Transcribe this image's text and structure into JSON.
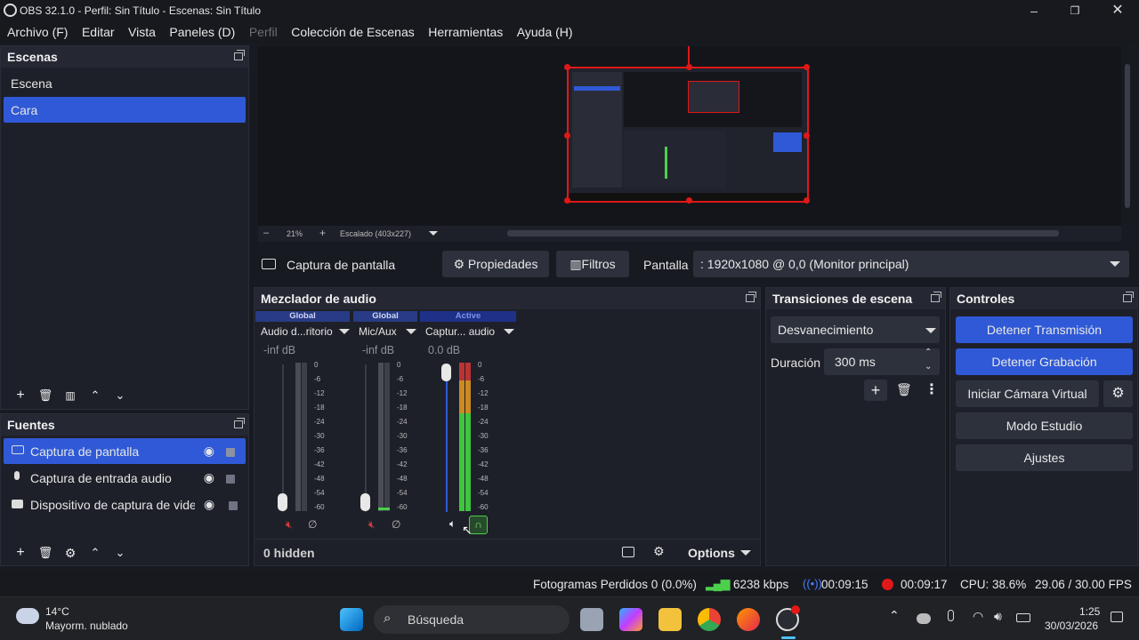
{
  "window": {
    "title": "OBS 32.1.0 - Perfil: Sin Título - Escenas: Sin Título"
  },
  "menu": [
    "Archivo (F)",
    "Editar",
    "Vista",
    "Paneles (D)",
    "Perfil",
    "Colección de Escenas",
    "Herramientas",
    "Ayuda (H)"
  ],
  "scenes": {
    "title": "Escenas",
    "items": [
      "Escena",
      "Cara"
    ],
    "selected_index": 1
  },
  "sources": {
    "title": "Fuentes",
    "items": [
      "Captura de pantalla",
      "Captura de entrada audio",
      "Dispositivo de captura de video"
    ]
  },
  "preview": {
    "zoom": "21%",
    "scale_label": "Escalado (403x227)"
  },
  "source_bar": {
    "source_name": "Captura de pantalla",
    "properties_label": "Propiedades",
    "filters_label": "Filtros",
    "display_label": "Pantalla",
    "display_value": ": 1920x1080 @ 0,0 (Monitor principal)"
  },
  "mixer": {
    "title": "Mezclador de audio",
    "channels": [
      {
        "badge": "Global",
        "name": "Audio d...ritorio",
        "db": "-inf dB",
        "level": 0.0
      },
      {
        "badge": "Global",
        "name": "Mic/Aux",
        "db": "-inf dB",
        "level": 0.0
      },
      {
        "badge": "Active",
        "name": "Captur... audio",
        "db": "0.0 dB",
        "level": 1.0
      }
    ],
    "scale": [
      "0",
      "-6",
      "-12",
      "-18",
      "-24",
      "-30",
      "-36",
      "-42",
      "-48",
      "-54",
      "-60"
    ],
    "hidden_label": "0 hidden",
    "options_label": "Options"
  },
  "transitions": {
    "title": "Transiciones de escena",
    "selected": "Desvanecimiento",
    "duration_label": "Duración",
    "duration_value": "300 ms"
  },
  "controls": {
    "title": "Controles",
    "stop_stream": "Detener Transmisión",
    "stop_record": "Detener Grabación",
    "virtual_cam": "Iniciar Cámara Virtual",
    "studio_mode": "Modo Estudio",
    "settings": "Ajustes"
  },
  "status": {
    "dropped_frames": "Fotogramas Perdidos 0 (0.0%)",
    "bitrate": "6238 kbps",
    "stream_time": "00:09:15",
    "record_time": "00:09:17",
    "cpu": "CPU: 38.6%",
    "fps": "29.06 / 30.00 FPS"
  },
  "taskbar": {
    "weather_temp": "14°C",
    "weather_desc": "Mayorm. nublado",
    "search_placeholder": "Búsqueda",
    "time": "1:25",
    "date": "30/03/2026"
  },
  "colors": {
    "accent": "#2f59d6",
    "record_red": "#e01818",
    "meter_green": "#4cd04c"
  }
}
